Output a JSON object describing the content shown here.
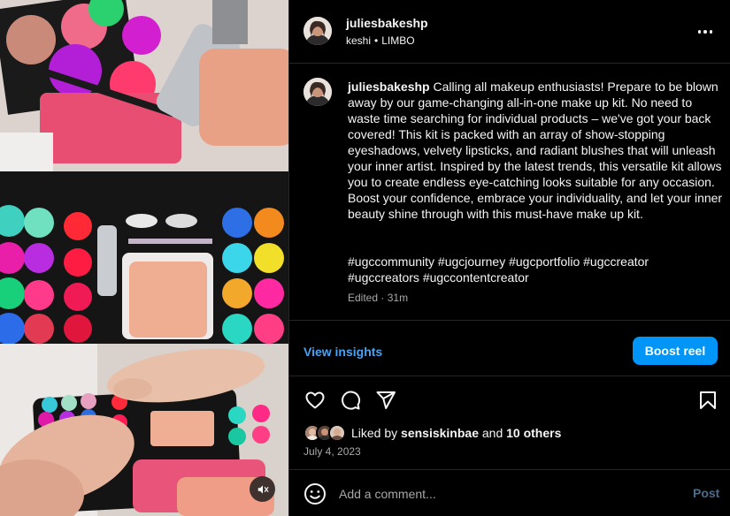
{
  "post": {
    "username": "juliesbakeshp",
    "audio_artist": "keshi",
    "audio_separator": "•",
    "audio_track": "LIMBO"
  },
  "caption": {
    "username": "juliesbakeshp",
    "text": "Calling all makeup enthusiasts! Prepare to be blown away by our game-changing all-in-one make up kit. No need to waste time searching for individual products – we've got your back covered! This kit is packed with an array of show-stopping eyeshadows, velvety lipsticks, and radiant blushes that will unleash your inner artist. Inspired by the latest trends, this versatile kit allows you to create endless eye-catching looks suitable for any occasion. Boost your confidence, embrace your individuality, and let your inner beauty shine through with this must-have make up kit.",
    "hashtags": "#ugccommunity #ugcjourney #ugcportfolio #ugccreator #ugccreators #ugccontentcreator",
    "edited_label": "Edited",
    "edited_separator": "·",
    "edited_time": "31m"
  },
  "insights": {
    "view_label": "View insights",
    "boost_label": "Boost reel"
  },
  "actions": {
    "like_icon": "heart-icon",
    "comment_icon": "comment-icon",
    "share_icon": "paper-plane-icon",
    "save_icon": "bookmark-icon"
  },
  "likes": {
    "prefix": "Liked by",
    "first_user": "sensiskinbae",
    "connector": "and",
    "others": "10 others"
  },
  "date": "July 4, 2023",
  "comment": {
    "placeholder": "Add a comment...",
    "post_label": "Post"
  },
  "colors": {
    "accent_blue": "#0095f6",
    "link_blue": "#4aa3f2",
    "muted_text": "#a8a8a8",
    "divider": "#262626"
  }
}
